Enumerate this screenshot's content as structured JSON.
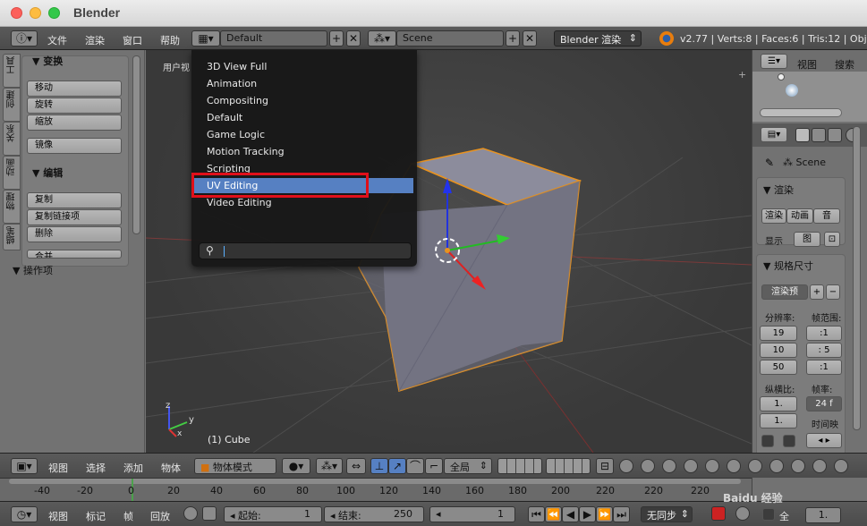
{
  "window": {
    "title": "Blender"
  },
  "info_header": {
    "menus": [
      "文件",
      "渲染",
      "窗口",
      "帮助"
    ],
    "screen_layout": "Default",
    "scene": "Scene",
    "engine": "Blender 渲染",
    "stats": "v2.77 | Verts:8 | Faces:6 | Tris:12 | Objec"
  },
  "tool_shelf": {
    "tabs": [
      "工具",
      "创建",
      "关系",
      "动画",
      "物理",
      "蜡笔"
    ],
    "transform": {
      "header": "变换",
      "buttons": [
        "移动",
        "旋转",
        "缩放"
      ],
      "mirror": "镜像"
    },
    "edit": {
      "header": "编辑",
      "buttons": [
        "复制",
        "复制链接项",
        "删除",
        "合并"
      ]
    },
    "operator_header": "操作项"
  },
  "viewport": {
    "view_label": "用户视",
    "object_label": "(1) Cube",
    "axis_y": "y",
    "axis_z": "z",
    "axis_x": "x"
  },
  "layout_dropdown": {
    "items": [
      "3D View Full",
      "Animation",
      "Compositing",
      "Default",
      "Game Logic",
      "Motion Tracking",
      "Scripting",
      "UV Editing",
      "Video Editing"
    ],
    "selected": "UV Editing"
  },
  "outliner": {
    "menus": [
      "视图",
      "搜索"
    ]
  },
  "properties": {
    "scene_label": "Scene",
    "render_panel": "渲染",
    "render_btns": [
      "渲染",
      "动画",
      "音"
    ],
    "display_label": "显示",
    "display_value": "图",
    "dimensions_panel": "规格尺寸",
    "render_preset": "渲染预",
    "resolution_label": "分辨率:",
    "frame_range_label": "帧范围:",
    "res_x": "19",
    "res_y": "10",
    "res_pct": "50",
    "frame_start": ":1",
    "frame_end": ": 5",
    "frame_step": ":1",
    "aspect_label": "纵横比:",
    "fps_label": "帧率:",
    "aspect_x": "1.",
    "aspect_y": "1.",
    "fps": "24 f",
    "time_remap": "时间映",
    "bottom_value": "1."
  },
  "viewport_header": {
    "menus": [
      "视图",
      "选择",
      "添加",
      "物体"
    ],
    "mode": "物体模式",
    "pivot": "全局"
  },
  "timeline": {
    "ticks": [
      "-40",
      "-20",
      "0",
      "20",
      "40",
      "60",
      "80",
      "100",
      "120",
      "140",
      "160",
      "180",
      "200",
      "220",
      "220",
      "220"
    ]
  },
  "timeline_header": {
    "menus": [
      "视图",
      "标记",
      "帧",
      "回放"
    ],
    "start_label": "起始:",
    "start_value": "1",
    "end_label": "结束:",
    "end_value": "250",
    "current_frame": "1",
    "sync": "无同步",
    "all_label": "全"
  },
  "watermark": "Baidu 经验"
}
